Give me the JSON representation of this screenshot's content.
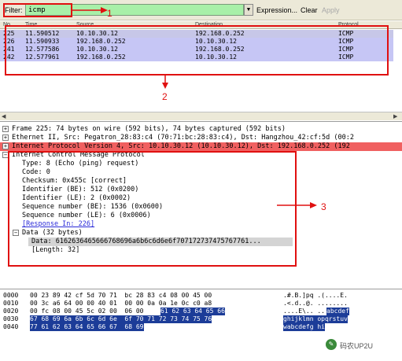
{
  "toolbar": {
    "filter_label": "Filter:",
    "filter_value": "icmp",
    "expression_label": "Expression...",
    "clear_label": "Clear",
    "apply_label": "Apply"
  },
  "packet_list": {
    "columns": [
      "No.",
      "Time",
      "Source",
      "Destination",
      "Protocol"
    ],
    "rows": [
      {
        "no": "225",
        "time": "11.590512",
        "source": "10.10.30.12",
        "destination": "192.168.0.252",
        "protocol": "ICMP",
        "color": "#c7c7e8"
      },
      {
        "no": "226",
        "time": "11.590933",
        "source": "192.168.0.252",
        "destination": "10.10.30.12",
        "protocol": "ICMP",
        "color": "#c6c6f5"
      },
      {
        "no": "241",
        "time": "12.577586",
        "source": "10.10.30.12",
        "destination": "192.168.0.252",
        "protocol": "ICMP",
        "color": "#c6c6f5"
      },
      {
        "no": "242",
        "time": "12.577961",
        "source": "192.168.0.252",
        "destination": "10.10.30.12",
        "protocol": "ICMP",
        "color": "#c6c6f5"
      }
    ]
  },
  "detail": {
    "frame": "Frame 225: 74 bytes on wire (592 bits), 74 bytes captured (592 bits)",
    "ethernet": "Ethernet II, Src: Pegatron_28:83:c4 (70:71:bc:28:83:c4), Dst: Hangzhou_42:cf:5d (00:2",
    "ip": "Internet Protocol Version 4, Src: 10.10.30.12 (10.10.30.12), Dst: 192.168.0.252 (192",
    "icmp": "Internet Control Message Protocol",
    "icmp_fields": [
      "Type: 8 (Echo (ping) request)",
      "Code: 0",
      "Checksum: 0x455c [correct]",
      "Identifier (BE): 512 (0x0200)",
      "Identifier (LE): 2 (0x0002)",
      "Sequence number (BE): 1536 (0x0600)",
      "Sequence number (LE): 6 (0x0006)"
    ],
    "response_in": "[Response In: 226]",
    "data_header": "Data (32 bytes)",
    "data_value": "Data: 6162636465666768696a6b6c6d6e6f707172737475767761...",
    "data_length": "[Length: 32]"
  },
  "bytes": [
    {
      "off": "0000",
      "hex": "00 23 89 42 cf 5d 70 71  bc 28 83 c4 08 00 45 00",
      "hex_hl": "",
      "asc": ".#.B.]pq .(....E.",
      "asc_hl": ""
    },
    {
      "off": "0010",
      "hex": "00 3c a6 64 00 00 40 01  00 00 0a 0a 1e 0c c0 a8",
      "hex_hl": "",
      "asc": ".<.d..@. ........",
      "asc_hl": ""
    },
    {
      "off": "0020",
      "hex": "00 fc 08 00 45 5c 02 00  06 00 ",
      "hex_hl": "61 62 63 64 65 66",
      "asc": "....E\\.. ..",
      "asc_hl": "abcdef"
    },
    {
      "off": "0030",
      "hex": "",
      "hex_hl": "67 68 69 6a 6b 6c 6d 6e  6f 70 71 72 73 74 75 76",
      "asc": "",
      "asc_hl": "ghijklmn opqrstuv"
    },
    {
      "off": "0040",
      "hex": "",
      "hex_hl": "77 61 62 63 64 65 66 67  68 69",
      "asc": "",
      "asc_hl": "wabcdefg hi"
    }
  ],
  "annotations": {
    "one": "1",
    "two": "2",
    "three": "3"
  },
  "watermark": "码农UP2U",
  "colors": {
    "annotation": "#e01010",
    "filter_ok": "#a8f0a8",
    "ip_row": "#f06060",
    "selected_row": "#c7c7e8",
    "byte_highlight": "#1c3c98"
  }
}
